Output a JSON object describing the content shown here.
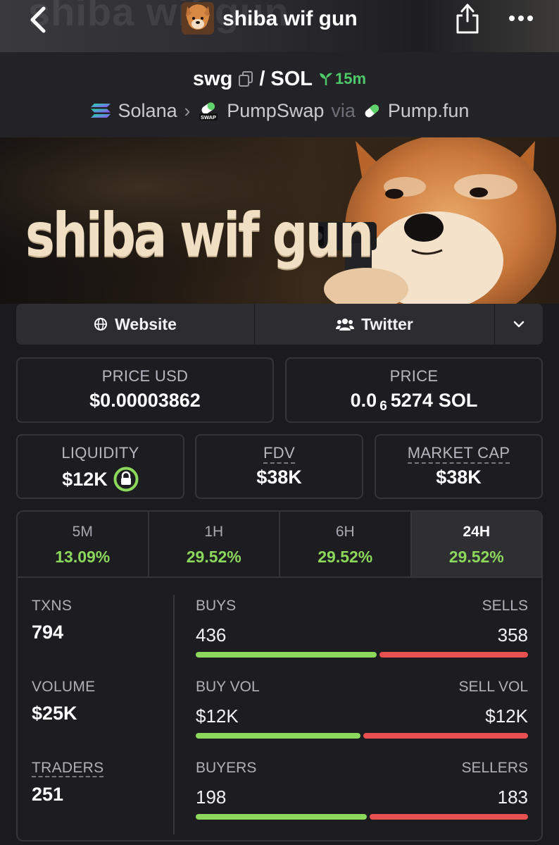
{
  "header": {
    "title": "shiba wif gun",
    "banner_text": "shiba wif gun"
  },
  "pair": {
    "base": "swg",
    "separator": "/",
    "quote": "SOL",
    "age": "15m",
    "chain": "Solana",
    "dex": "PumpSwap",
    "dex_badge": "SWAP",
    "via_label": "via",
    "launchpad": "Pump.fun"
  },
  "links": {
    "website": "Website",
    "twitter": "Twitter"
  },
  "price": {
    "usd_label": "PRICE USD",
    "usd_value": "$0.00003862",
    "native_label": "PRICE",
    "native_prefix": "0.0",
    "native_zeros": "6",
    "native_digits": "5274",
    "native_unit": "SOL"
  },
  "cards": {
    "liquidity_label": "LIQUIDITY",
    "liquidity_value": "$12K",
    "fdv_label": "FDV",
    "fdv_value": "$38K",
    "mcap_label": "MARKET CAP",
    "mcap_value": "$38K"
  },
  "timeframes": [
    {
      "label": "5M",
      "change": "13.09%"
    },
    {
      "label": "1H",
      "change": "29.52%"
    },
    {
      "label": "6H",
      "change": "29.52%"
    },
    {
      "label": "24H",
      "change": "29.52%"
    }
  ],
  "stats": {
    "txns_label": "TXNS",
    "txns_value": "794",
    "volume_label": "VOLUME",
    "volume_value": "$25K",
    "traders_label": "TRADERS",
    "traders_value": "251",
    "buys_label": "BUYS",
    "buys_value": "436",
    "sells_label": "SELLS",
    "sells_value": "358",
    "buy_vol_label": "BUY VOL",
    "buy_vol_value": "$12K",
    "sell_vol_label": "SELL VOL",
    "sell_vol_value": "$12K",
    "buyers_label": "BUYERS",
    "buyers_value": "198",
    "sellers_label": "SELLERS",
    "sellers_value": "183"
  },
  "bars": {
    "txns_buy_fraction": 0.549,
    "volume_buy_fraction": 0.5,
    "traders_buy_fraction": 0.52
  },
  "colors": {
    "accent_green": "#8cd85a",
    "accent_red": "#e8504f",
    "age_green": "#4ec96a",
    "lock_green": "#8cd85a"
  },
  "icons": [
    "back-arrow-icon",
    "share-icon",
    "more-icon",
    "copy-icon",
    "seedling-icon",
    "solana-icon",
    "pumpswap-icon",
    "pill-icon",
    "globe-icon",
    "users-icon",
    "chevron-down-icon",
    "lock-icon"
  ]
}
